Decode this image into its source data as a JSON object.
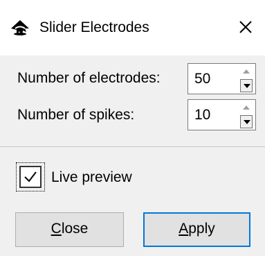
{
  "window": {
    "title": "Slider Electrodes",
    "app_icon": "inkscape-icon",
    "close_icon": "close-icon"
  },
  "fields": {
    "electrodes": {
      "label": "Number of electrodes:",
      "value": "50"
    },
    "spikes": {
      "label": "Number of spikes:",
      "value": "10"
    }
  },
  "live_preview": {
    "label": "Live preview",
    "checked": true
  },
  "buttons": {
    "close": {
      "label": "Close",
      "mnemonic": "C",
      "rest": "lose"
    },
    "apply": {
      "label": "Apply",
      "mnemonic": "A",
      "rest": "pply"
    }
  },
  "colors": {
    "accent": "#0078d7",
    "dialog_bg": "#f0f0f0",
    "titlebar_bg": "#ffffff"
  }
}
